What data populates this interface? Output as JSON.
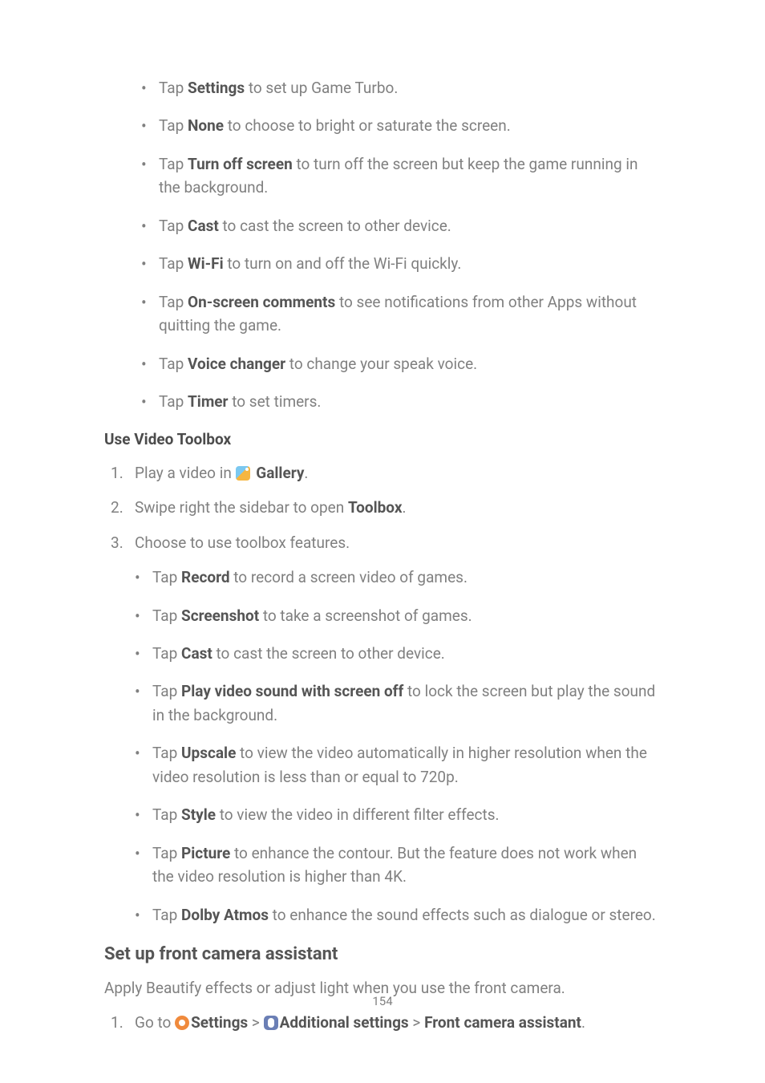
{
  "topBullets": [
    {
      "pre": "Tap ",
      "bold": "Settings",
      "post": " to set up Game Turbo."
    },
    {
      "pre": "Tap ",
      "bold": "None",
      "post": " to choose to bright or saturate the screen."
    },
    {
      "pre": "Tap ",
      "bold": "Turn off screen",
      "post": " to turn off the screen but keep the game running in the background."
    },
    {
      "pre": "Tap ",
      "bold": "Cast",
      "post": " to cast the screen to other device."
    },
    {
      "pre": "Tap ",
      "bold": "Wi-Fi",
      "post": " to turn on and off the Wi-Fi quickly."
    },
    {
      "pre": "Tap ",
      "bold": "On-screen comments",
      "post": " to see notifications from other Apps without quitting the game."
    },
    {
      "pre": "Tap ",
      "bold": "Voice changer",
      "post": " to change your speak voice."
    },
    {
      "pre": "Tap ",
      "bold": "Timer",
      "post": " to set timers."
    }
  ],
  "section1Title": "Use Video Toolbox",
  "ol1": {
    "item1_pre": "Play a video in ",
    "item1_bold": "Gallery",
    "item1_post": ".",
    "item2_pre": "Swipe right the sidebar to open ",
    "item2_bold": "Toolbox",
    "item2_post": ".",
    "item3": "Choose to use toolbox features."
  },
  "midBullets": [
    {
      "pre": "Tap ",
      "bold": "Record",
      "post": " to record a screen video of games."
    },
    {
      "pre": "Tap ",
      "bold": "Screenshot",
      "post": " to take a screenshot of games."
    },
    {
      "pre": "Tap ",
      "bold": "Cast",
      "post": " to cast the screen to other device."
    },
    {
      "pre": "Tap ",
      "bold": "Play video sound with screen off",
      "post": " to lock the screen but play the sound in the background."
    },
    {
      "pre": "Tap ",
      "bold": "Upscale",
      "post": " to view the video automatically in higher resolution when the video resolution is less than or equal to 720p."
    },
    {
      "pre": "Tap ",
      "bold": "Style",
      "post": " to view the video in different filter effects."
    },
    {
      "pre": "Tap ",
      "bold": "Picture",
      "post": " to enhance the contour. But the feature does not work when the video resolution is higher than 4K."
    },
    {
      "pre": "Tap ",
      "bold": "Dolby Atmos",
      "post": " to enhance the sound effects such as dialogue or stereo."
    }
  ],
  "h3": "Set up front camera assistant",
  "h3sub": "Apply Beautify effects or adjust light when you use the front camera.",
  "ol2": {
    "pre": "Go to ",
    "b1": "Settings",
    "sep": " > ",
    "b2": "Additional settings",
    "b3": "Front camera assistant",
    "post": "."
  },
  "pageNumber": "154"
}
